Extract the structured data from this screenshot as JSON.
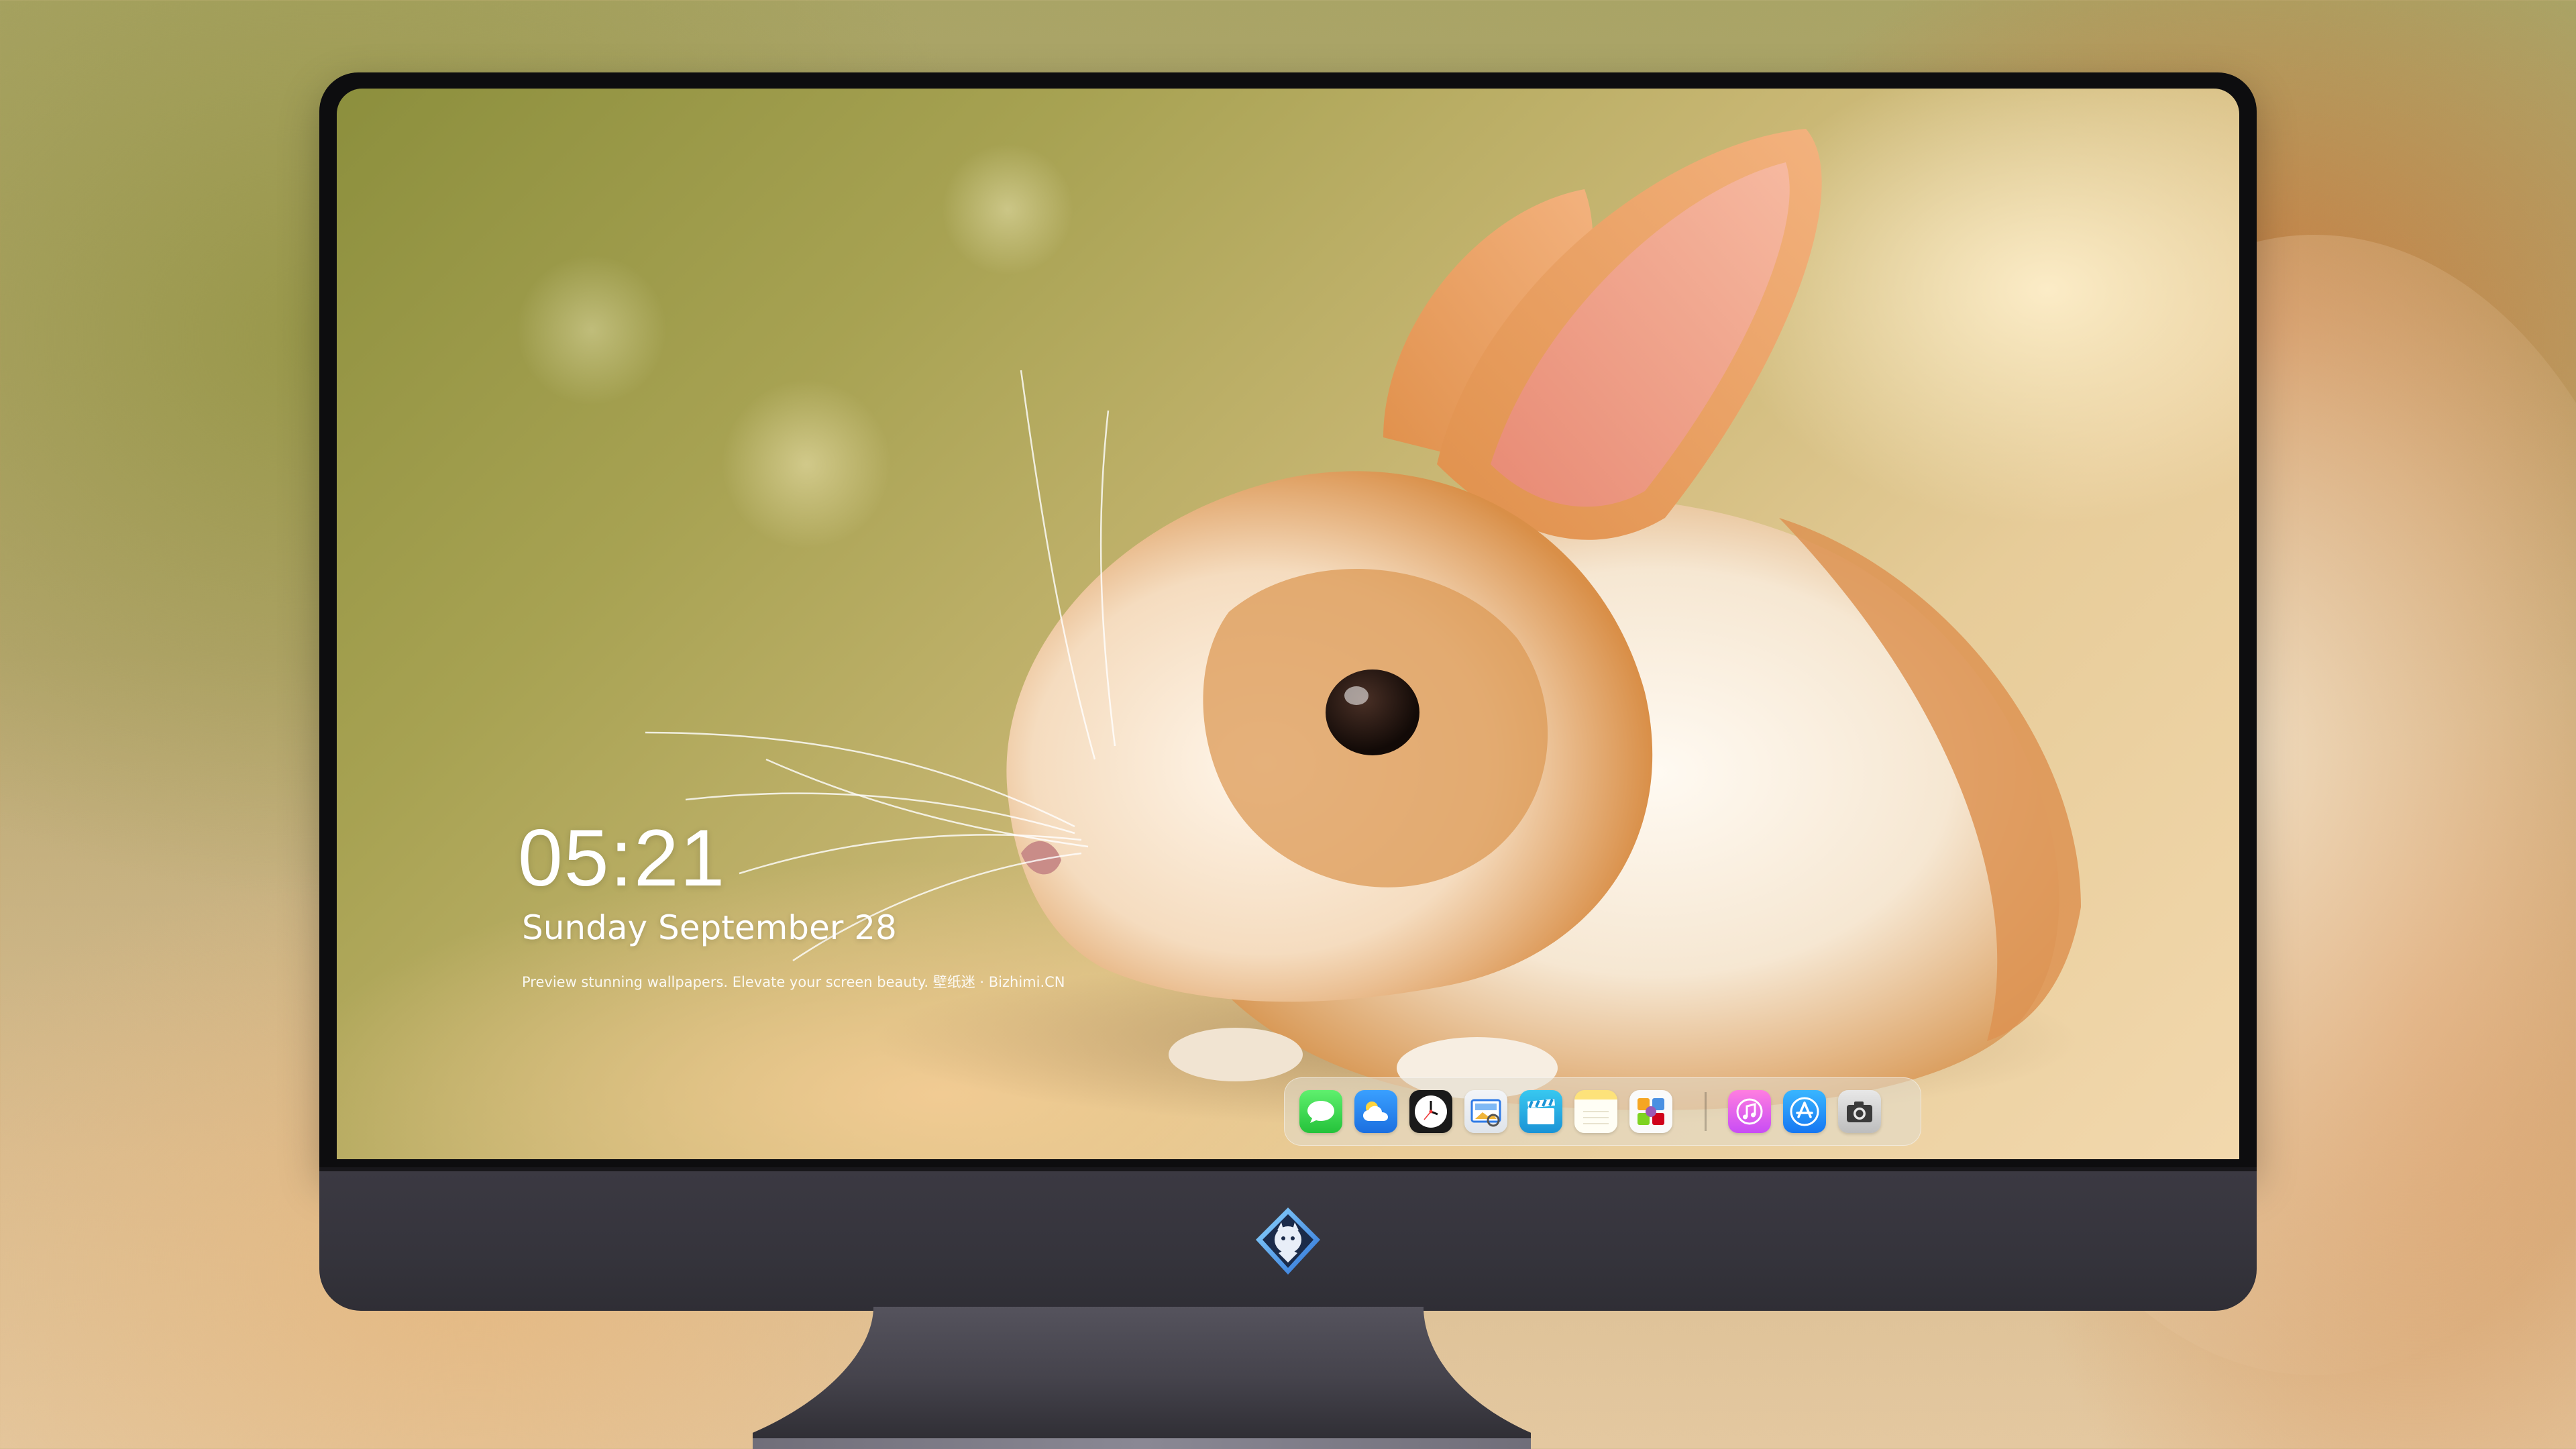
{
  "lock_screen": {
    "time": "05:21",
    "date": "Sunday September   28",
    "tagline": "Preview stunning wallpapers. Elevate your screen beauty. 壁纸迷 · Bizhimi.CN"
  },
  "dock": {
    "apps": [
      {
        "name": "Messages",
        "icon": "messages-icon"
      },
      {
        "name": "Weather",
        "icon": "weather-icon"
      },
      {
        "name": "Clock",
        "icon": "clock-icon"
      },
      {
        "name": "Preview",
        "icon": "preview-icon"
      },
      {
        "name": "Clips",
        "icon": "clapperboard-icon"
      },
      {
        "name": "Notes",
        "icon": "notes-icon"
      },
      {
        "name": "Photos",
        "icon": "photos-icon"
      },
      {
        "name": "Music",
        "icon": "music-note-icon"
      },
      {
        "name": "App Store",
        "icon": "app-store-icon"
      },
      {
        "name": "Camera",
        "icon": "camera-icon"
      }
    ]
  },
  "colors": {
    "dock_background": "#e1dccd",
    "chin": "#38363e",
    "bezel": "#0d0d0f",
    "text": "#ffffff"
  }
}
